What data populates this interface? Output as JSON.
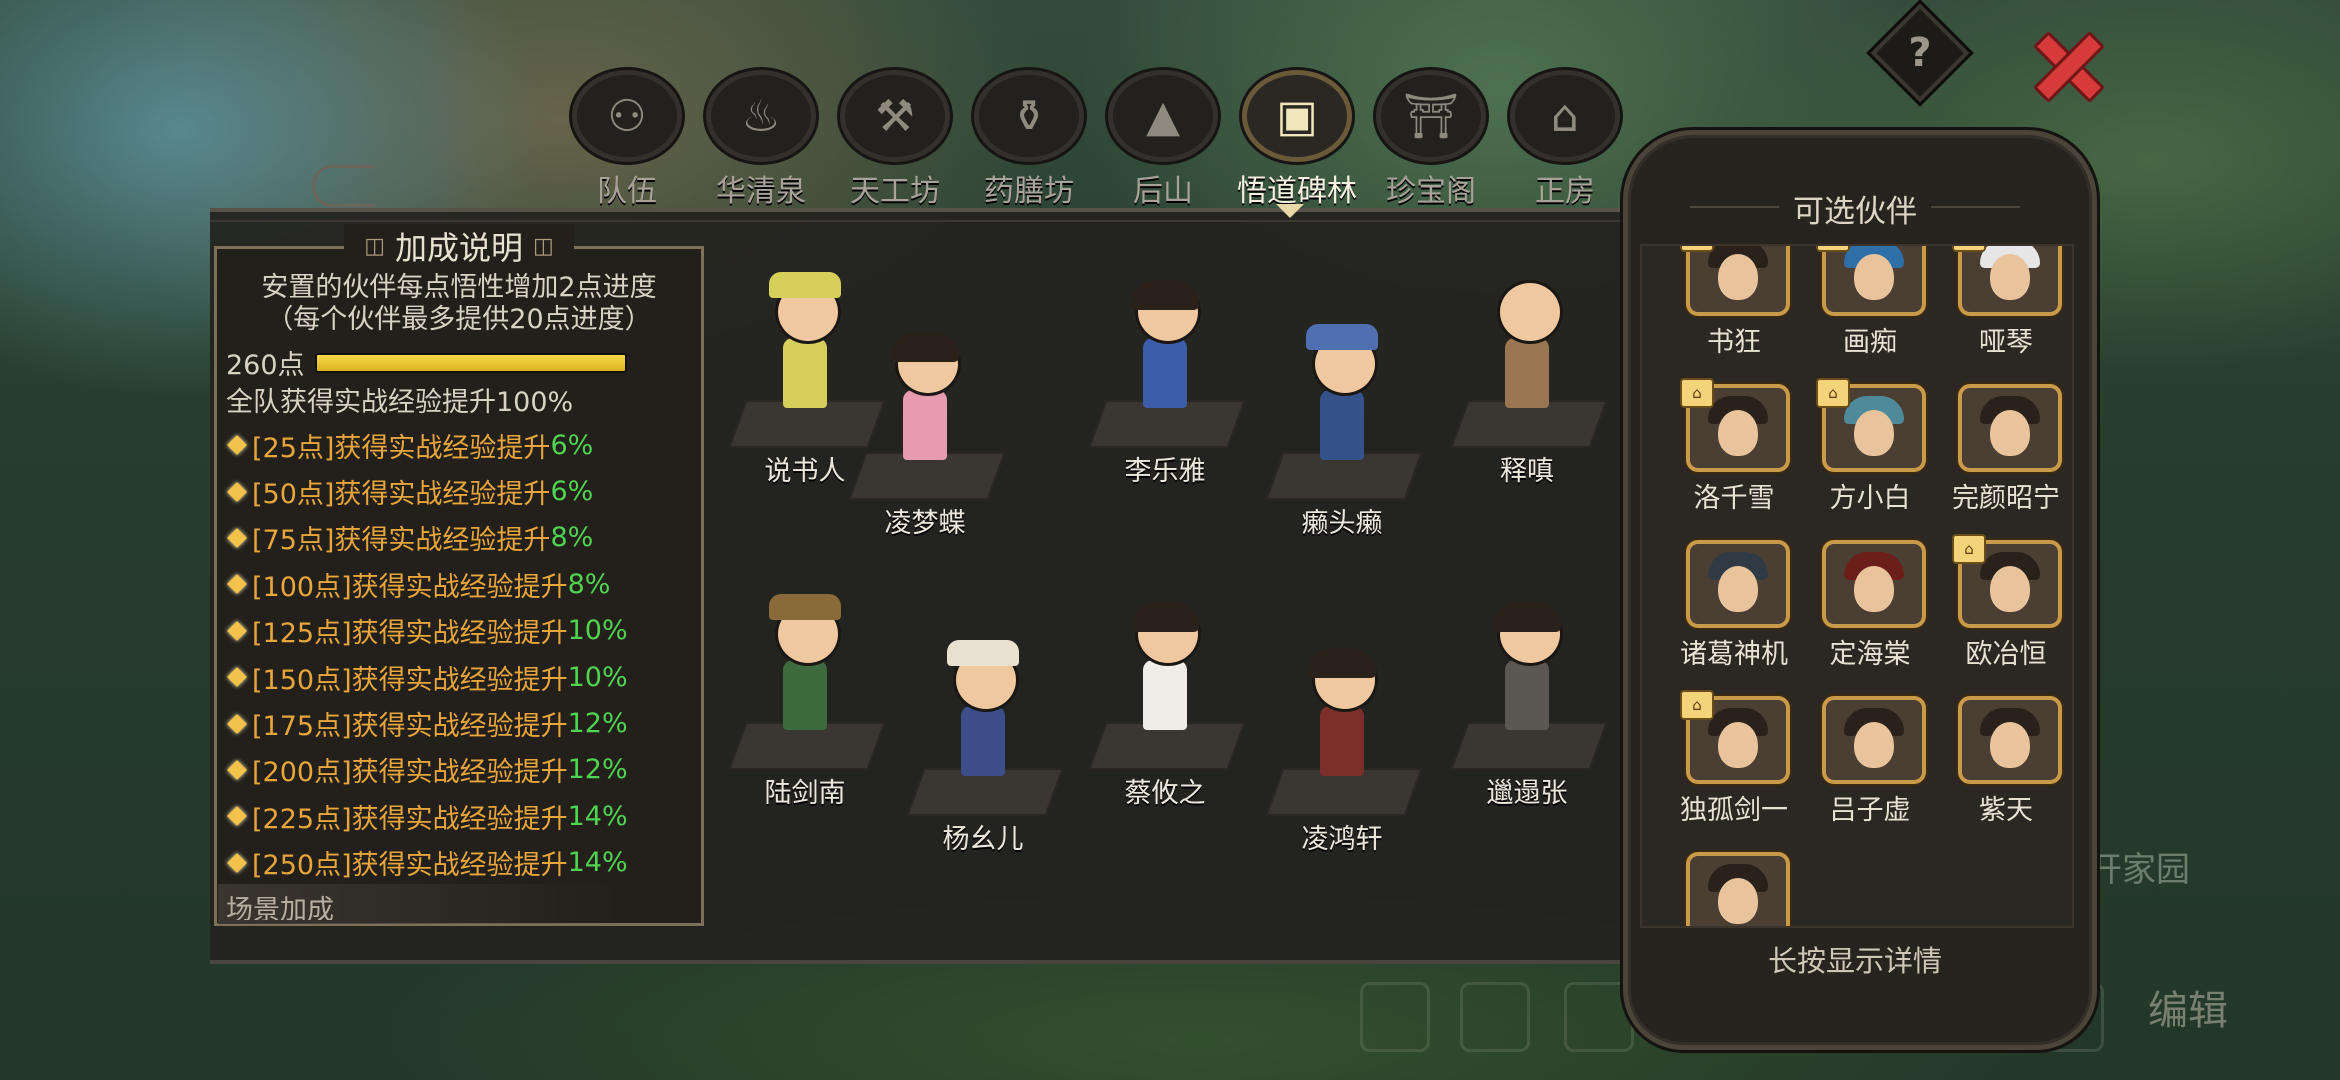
{
  "header": {
    "help_label": "?",
    "tabs": [
      {
        "label": "队伍",
        "icon": "team-icon"
      },
      {
        "label": "华清泉",
        "icon": "hot-spring-icon"
      },
      {
        "label": "天工坊",
        "icon": "workshop-icon"
      },
      {
        "label": "药膳坊",
        "icon": "medicine-icon"
      },
      {
        "label": "后山",
        "icon": "mountain-icon"
      },
      {
        "label": "悟道碑林",
        "icon": "stele-icon",
        "active": true
      },
      {
        "label": "珍宝阁",
        "icon": "treasure-pavilion-icon"
      },
      {
        "label": "正房",
        "icon": "main-house-icon"
      }
    ]
  },
  "info": {
    "title": "加成说明",
    "description_line1": "安置的伙伴每点悟性增加2点进度",
    "description_line2": "（每个伙伴最多提供20点进度）",
    "points": "260点",
    "progress_fraction": 1.0,
    "team_bonus": "全队获得实战经验提升100%",
    "bonuses": [
      {
        "text": "[25点]获得实战经验提升",
        "pct": "6%"
      },
      {
        "text": "[50点]获得实战经验提升",
        "pct": "6%"
      },
      {
        "text": "[75点]获得实战经验提升",
        "pct": "8%"
      },
      {
        "text": "[100点]获得实战经验提升",
        "pct": "8%"
      },
      {
        "text": "[125点]获得实战经验提升",
        "pct": "10%"
      },
      {
        "text": "[150点]获得实战经验提升",
        "pct": "10%"
      },
      {
        "text": "[175点]获得实战经验提升",
        "pct": "12%"
      },
      {
        "text": "[200点]获得实战经验提升",
        "pct": "12%"
      },
      {
        "text": "[225点]获得实战经验提升",
        "pct": "14%"
      },
      {
        "text": "[250点]获得实战经验提升",
        "pct": "14%"
      }
    ],
    "scene_bonus": "场景加成"
  },
  "placed_characters": [
    {
      "name": "说书人"
    },
    {
      "name": "凌梦蝶"
    },
    {
      "name": "李乐雅"
    },
    {
      "name": "癞头癞"
    },
    {
      "name": "释嗔"
    },
    {
      "name": "陆剑南"
    },
    {
      "name": "杨幺儿"
    },
    {
      "name": "蔡攸之"
    },
    {
      "name": "凌鸿轩"
    },
    {
      "name": "邋遢张"
    }
  ],
  "partners": {
    "title": "可选伙伴",
    "footer": "长按显示详情",
    "items": [
      {
        "name": "书狂",
        "badge": true
      },
      {
        "name": "画痴",
        "badge": true
      },
      {
        "name": "哑琴",
        "badge": true
      },
      {
        "name": "洛千雪",
        "badge": true
      },
      {
        "name": "方小白",
        "badge": true
      },
      {
        "name": "完颜昭宁",
        "badge": false
      },
      {
        "name": "诸葛神机",
        "badge": false
      },
      {
        "name": "定海棠",
        "badge": false
      },
      {
        "name": "欧冶恒",
        "badge": true
      },
      {
        "name": "独孤剑一",
        "badge": true
      },
      {
        "name": "吕子虚",
        "badge": false
      },
      {
        "name": "紫天",
        "badge": false
      },
      {
        "name": "",
        "badge": false
      }
    ]
  },
  "background_hud": {
    "edit_label": "编辑",
    "home_label": "开家园"
  }
}
